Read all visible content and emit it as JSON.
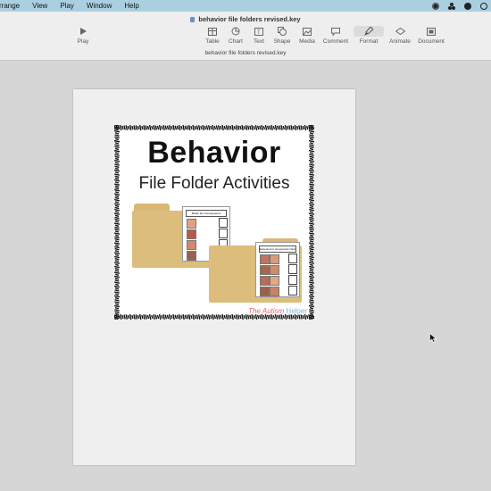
{
  "menubar": {
    "items": [
      "rrange",
      "View",
      "Play",
      "Window",
      "Help"
    ]
  },
  "toolbar": {
    "document_title": "behavior file folders revised.key",
    "document_subtitle": "behavior file folders revised.key",
    "play_label": "Play",
    "buttons": [
      "Table",
      "Chart",
      "Text",
      "Shape",
      "Media",
      "Comment",
      "Format",
      "Animate",
      "Document"
    ]
  },
  "slide": {
    "title": "Behavior",
    "subtitle": "File Folder Activities",
    "folder1_header": "Match the Consequence",
    "folder2_header": "Expected or unexpected choice?",
    "brand_part1": "The Autism",
    "brand_part2": "Helper"
  },
  "colors": {
    "menubar": "#aacfe0",
    "toolbar": "#eeeeee",
    "canvas": "#d6d6d6",
    "folder": "#dcbd7b"
  }
}
